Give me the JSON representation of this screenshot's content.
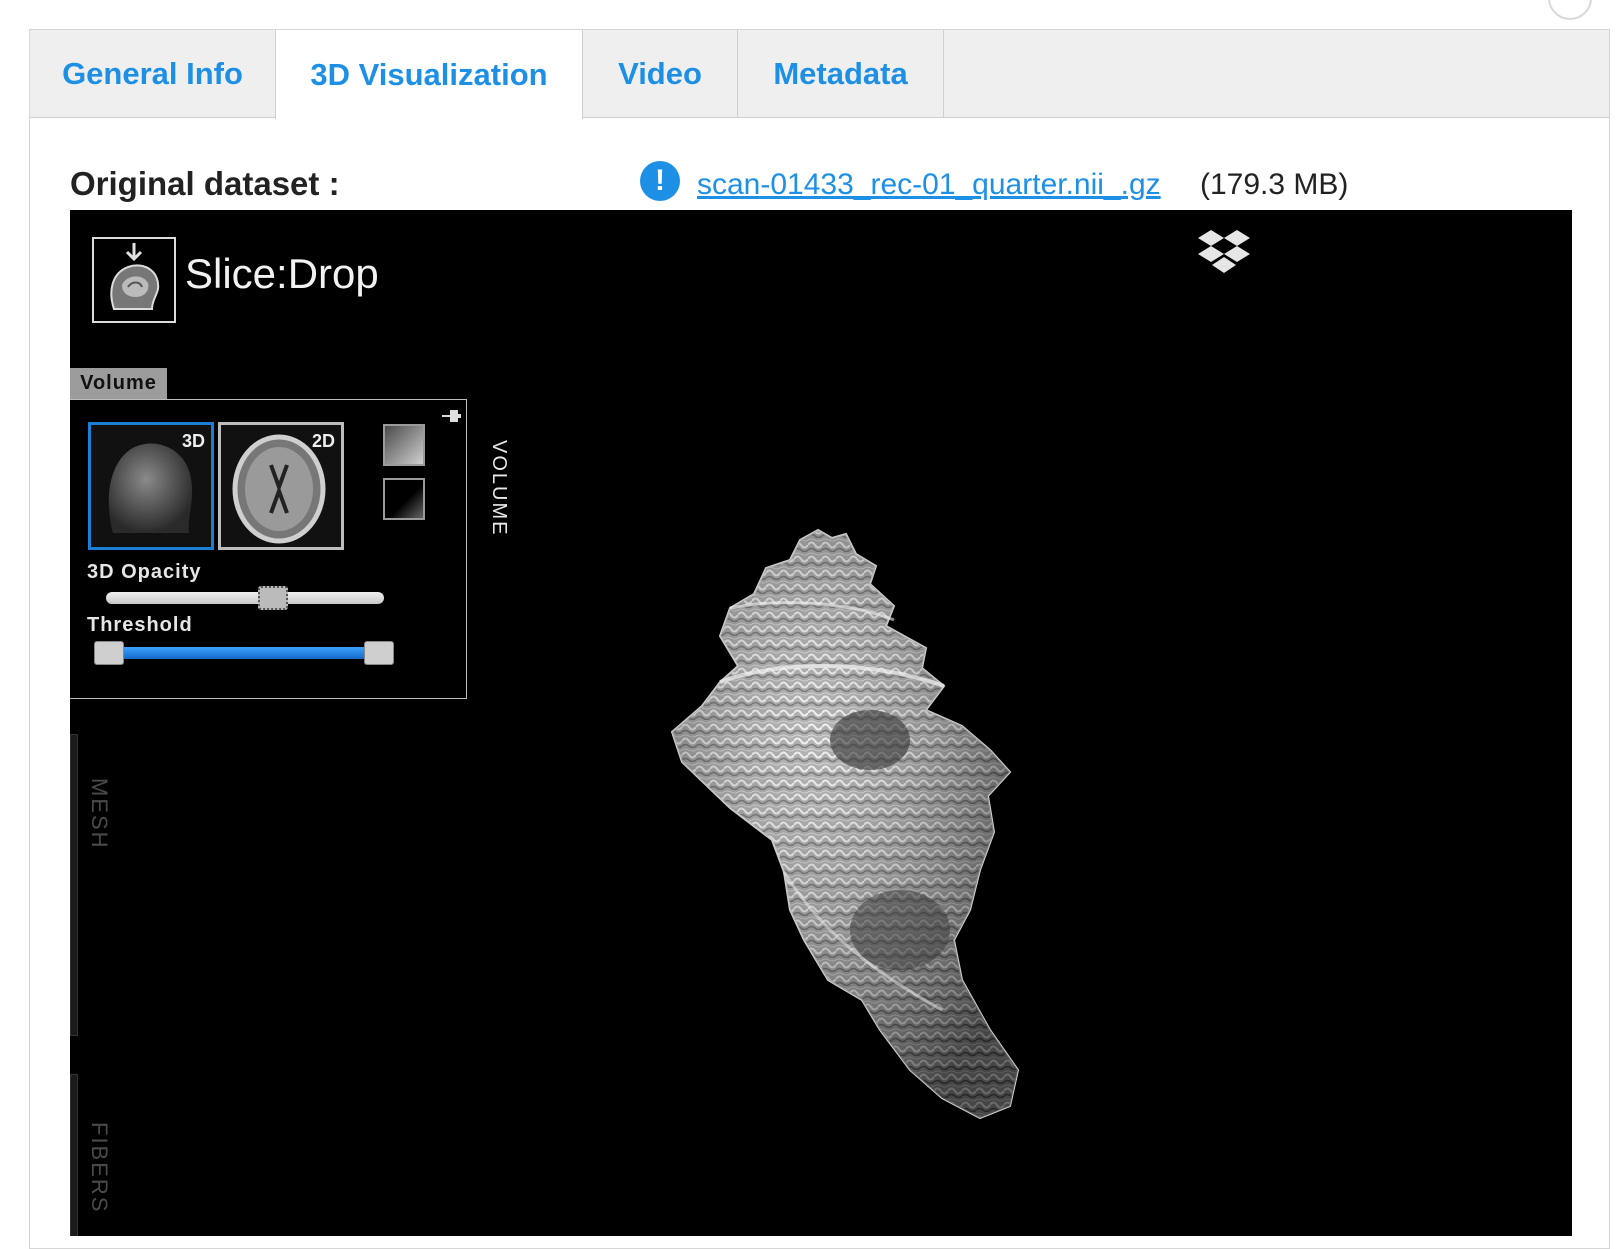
{
  "tabs": [
    {
      "label": "General Info",
      "active": false
    },
    {
      "label": "3D Visualization",
      "active": true
    },
    {
      "label": "Video",
      "active": false
    },
    {
      "label": "Metadata",
      "active": false
    }
  ],
  "dataset": {
    "label": "Original dataset :",
    "info_glyph": "!",
    "file_name": "scan-01433_rec-01_quarter.nii_.gz",
    "file_size": "(179.3 MB)"
  },
  "viewer": {
    "logo_text": "Slice:Drop",
    "volume_tab": "Volume",
    "thumb_3d_tag": "3D",
    "thumb_2d_tag": "2D",
    "opacity_label": "3D Opacity",
    "threshold_label": "Threshold",
    "opacity_value": 0.6,
    "threshold_min": 0.0,
    "threshold_max": 1.0,
    "volume_side_label": "VOLUME",
    "mesh_side_label": "MESH",
    "fibers_side_label": "FIBERS"
  },
  "colors": {
    "accent": "#1d90e6",
    "selection": "#1b7fd6",
    "viewer_bg": "#000000"
  },
  "icons": [
    "info-icon",
    "dropbox-icon",
    "pin-icon",
    "slicedrop-logo-icon"
  ]
}
